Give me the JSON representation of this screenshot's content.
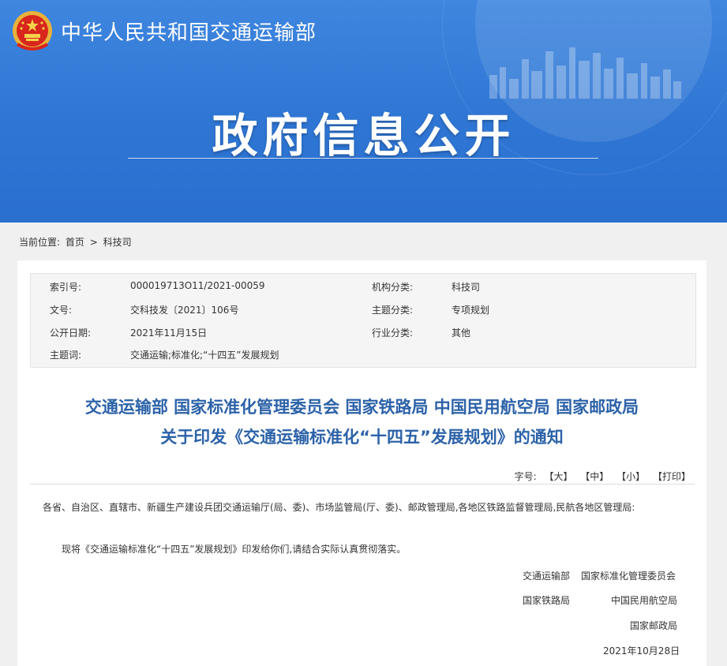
{
  "header": {
    "site_name": "中华人民共和国交通运输部",
    "banner_title": "政府信息公开"
  },
  "breadcrumb": {
    "prefix": "当前位置:",
    "home": "首页",
    "separator": ">",
    "current": "科技司"
  },
  "meta": {
    "index_label": "索引号:",
    "index_value": "000019713O11/2021-00059",
    "org_label": "机构分类:",
    "org_value": "科技司",
    "doc_label": "文号:",
    "doc_value": "交科技发〔2021〕106号",
    "theme_label": "主题分类:",
    "theme_value": "专项规划",
    "date_label": "公开日期:",
    "date_value": "2021年11月15日",
    "industry_label": "行业分类:",
    "industry_value": "其他",
    "keyword_label": "主题词:",
    "keyword_value": "交通运输;标准化;“十四五”发展规划"
  },
  "article": {
    "title_line1": "交通运输部 国家标准化管理委员会 国家铁路局 中国民用航空局 国家邮政局",
    "title_line2": "关于印发《交通运输标准化“十四五”发展规划》的通知",
    "font_label": "字号:",
    "font_large": "【大】",
    "font_medium": "【中】",
    "font_small": "【小】",
    "print": "【打印】",
    "addressee": "各省、自治区、直辖市、新疆生产建设兵团交通运输厅(局、委)、市场监管局(厅、委)、邮政管理局,各地区铁路监督管理局,民航各地区管理局:",
    "body": "现将《交通运输标准化“十四五”发展规划》印发给你们,请结合实际认真贯彻落实。",
    "signers": {
      "s1": "交通运输部",
      "s2": "国家标准化管理委员会",
      "s3": "国家铁路局",
      "s4": "中国民用航空局",
      "s5": "国家邮政局",
      "date": "2021年10月28日"
    }
  },
  "colors": {
    "banner_blue": "#3f86df",
    "title_blue": "#2c62a8"
  }
}
